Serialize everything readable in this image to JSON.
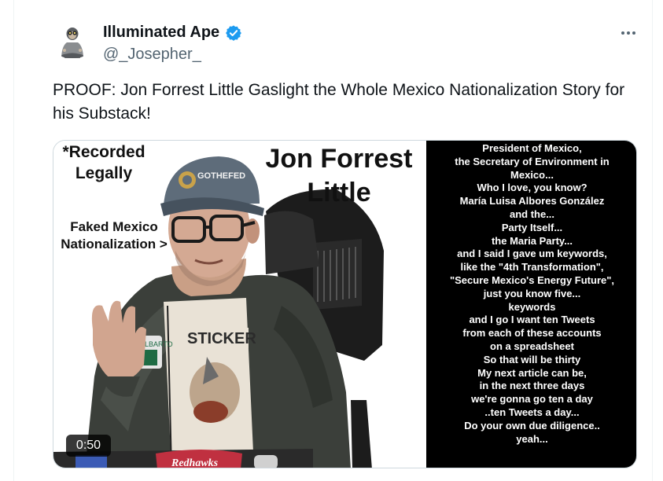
{
  "author": {
    "name": "Illuminated Ape",
    "handle": "@_Josepher_",
    "verified": true
  },
  "tweet": {
    "text": "PROOF: Jon Forrest Little Gaslight the Whole Mexico Nationalization Story for his Substack!"
  },
  "media": {
    "overlay": {
      "recorded_lines": [
        "*Recorded",
        "Legally"
      ],
      "faked_lines": [
        "Faked Mexico",
        "Nationalization >"
      ],
      "name_lines": [
        "Jon Forrest",
        "Little"
      ],
      "cap_text": "GOTHEFED",
      "shirt_text": "STICKER",
      "laptop_text": "Redhawks"
    },
    "quote_lines": [
      "President of Mexico,",
      "the Secretary of Environment in",
      "Mexico...",
      "Who I love, you know?",
      "María Luisa Albores González",
      "and the...",
      "Party Itself...",
      "the Maria Party...",
      "and I said I gave um keywords,",
      "like the \"4th Transformation\",",
      "\"Secure Mexico's Energy Future\",",
      "just you know five...",
      "keywords",
      "and I go I want ten Tweets",
      "from each of these accounts",
      "on a spreadsheet",
      "So that will be thirty",
      "My next article can be,",
      "in the next three days",
      "we're gonna go ten a day",
      "..ten Tweets a day...",
      "Do your own due diligence..",
      "yeah..."
    ],
    "duration": "0:50"
  },
  "colors": {
    "text_primary": "#0f1419",
    "text_secondary": "#536471",
    "verified_blue": "#1d9bf0",
    "media_border": "#cfd9de"
  },
  "icons": {
    "verified": "verified-badge-icon",
    "more": "more-options-icon"
  }
}
